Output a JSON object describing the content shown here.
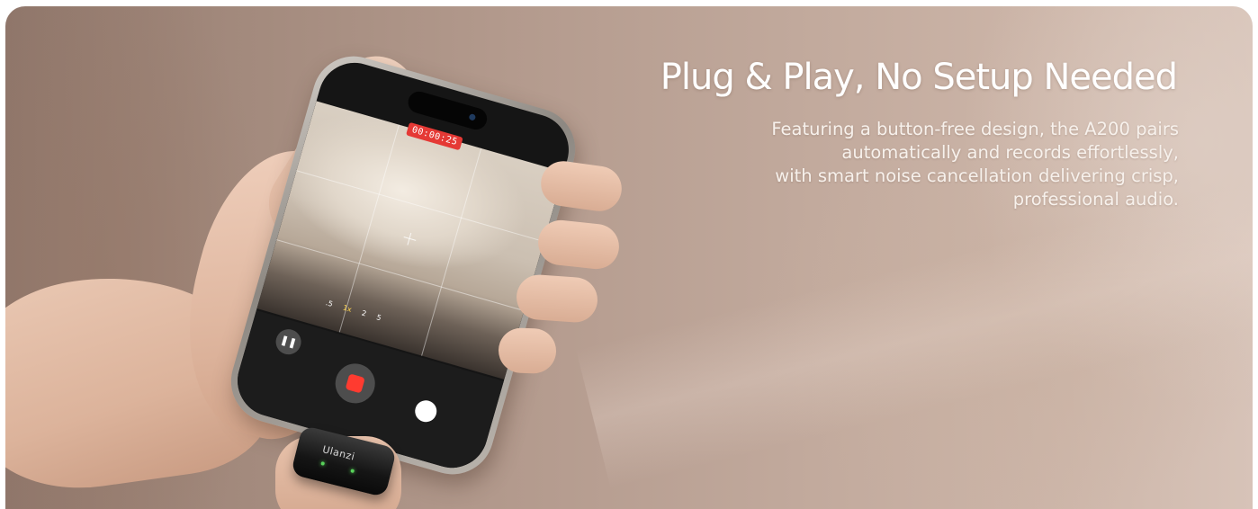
{
  "banner": {
    "headline": "Plug & Play, No Setup Needed",
    "description_lines": [
      "Featuring a button-free design, the A200 pairs",
      "automatically and records effortlessly,",
      "with smart noise cancellation delivering crisp,",
      "professional audio."
    ]
  },
  "phone_screen": {
    "recording_time": "00:00:25",
    "zoom_levels": [
      ".5",
      "1x",
      "2",
      "5"
    ],
    "active_zoom": "1x",
    "pause_icon": "pause-icon",
    "record_icon": "stop-record-icon",
    "shutter_icon": "shutter-icon"
  },
  "receiver": {
    "brand": "Ulanzi"
  },
  "colors": {
    "record_red": "#ff3b30",
    "timestamp_red": "#e53935",
    "text": "#ffffff"
  }
}
